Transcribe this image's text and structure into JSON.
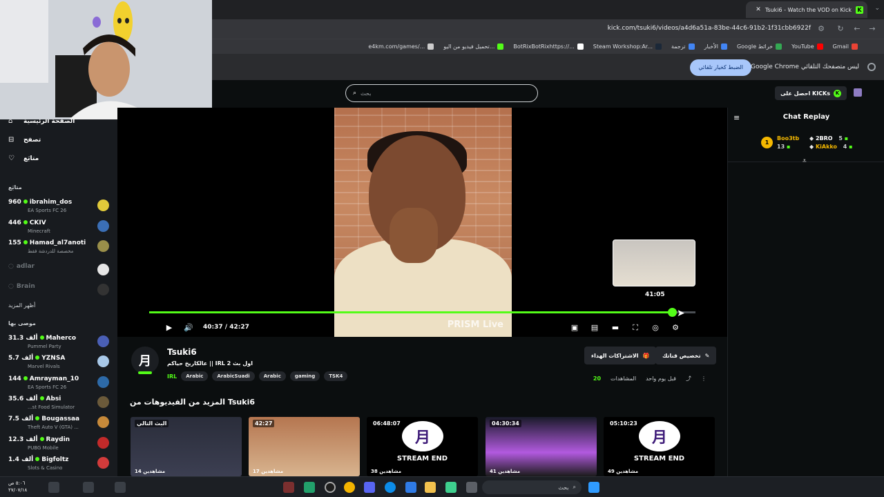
{
  "browser": {
    "tab_title": "Tsuki6 - Watch the VOD on Kick",
    "url": "kick.com/tsuki6/videos/a4d6a51a-83be-44c6-91b2-1f31cbb6922f",
    "bookmarks": [
      {
        "label": "Gmail",
        "color": "#ea4335"
      },
      {
        "label": "YouTube",
        "color": "#ff0000"
      },
      {
        "label": "Google خرائط",
        "color": "#34a853"
      },
      {
        "label": "الأخبار",
        "color": "#4285f4"
      },
      {
        "label": "ترجمة",
        "color": "#4285f4"
      },
      {
        "label": "Steam Workshop:Ar...",
        "color": "#1b2838"
      },
      {
        "label": "BotRixBotRixhttps://...",
        "color": "#ffffff"
      },
      {
        "label": "تحميل فيديو من اليو...",
        "color": "#53fc18"
      },
      {
        "label": "e4km.com/games/...",
        "color": "#cccccc"
      }
    ],
    "infobar_message": "Google Chrome ليس متصفحك التلقائي",
    "infobar_button": "الضبط كخيار تلقائي"
  },
  "header": {
    "search_placeholder": "بحث",
    "get_kicks": "احصل على KICKs"
  },
  "sidebar": {
    "nav": [
      {
        "label": "الصفحة الرئيسية",
        "icon": "home-icon"
      },
      {
        "label": "تصفح",
        "icon": "browse-icon"
      },
      {
        "label": "متابَع",
        "icon": "heart-icon"
      }
    ],
    "following_heading": "متابَع",
    "following": [
      {
        "viewers": "960",
        "name": "ibrahim_dos",
        "game": "EA Sports FC 26",
        "live": true,
        "avatar_color": "#e0c93a"
      },
      {
        "viewers": "446",
        "name": "CKIV",
        "game": "Minecraft",
        "live": true,
        "avatar_color": "#3b6fb6"
      },
      {
        "viewers": "155",
        "name": "Hamad_al7anoti",
        "game": "مخصصة للدردشة فقط",
        "live": true,
        "avatar_color": "#9a8f4a"
      },
      {
        "viewers": "",
        "name": "adlar",
        "game": "",
        "live": false,
        "avatar_color": "#e6e6e6"
      },
      {
        "viewers": "",
        "name": "Brain",
        "game": "",
        "live": false,
        "avatar_color": "#333333"
      }
    ],
    "show_more": "أظهر المزيد",
    "recommended_heading": "موصى بها",
    "recommended": [
      {
        "viewers": "31.3 ألف",
        "name": "Maherco",
        "game": "Pummel Party",
        "avatar_color": "#4a5fb5"
      },
      {
        "viewers": "5.7 ألف",
        "name": "YZNSA",
        "game": "Marvel Rivals",
        "avatar_color": "#a8c8e8"
      },
      {
        "viewers": "144",
        "name": "Amrayman_10",
        "game": "EA Sports FC 26",
        "avatar_color": "#2d6aa8"
      },
      {
        "viewers": "35.6 ألف",
        "name": "Absi",
        "game": "...st Food Simulator",
        "avatar_color": "#6b5a3a"
      },
      {
        "viewers": "7.5 ألف",
        "name": "Bougassaa",
        "game": "Theft Auto V (GTA) ...",
        "avatar_color": "#c78a3a"
      },
      {
        "viewers": "12.3 ألف",
        "name": "Raydin",
        "game": "PUBG Mobile",
        "avatar_color": "#c22a2a"
      },
      {
        "viewers": "1.4 ألف",
        "name": "Bigfoltz",
        "game": "Slots & Casino",
        "avatar_color": "#d23b3b"
      }
    ]
  },
  "player": {
    "watermark": "PRISM Live",
    "preview_time": "41:05",
    "current_time": "40:37",
    "duration": "42:27",
    "progress_fraction": 0.957
  },
  "chat": {
    "title": "Chat Replay",
    "rank": "1",
    "leaders": [
      {
        "name": "Boo3tb",
        "count": "13",
        "color": "#f5b800"
      },
      {
        "name": "2BRO",
        "count": "5",
        "color": "#ffffff"
      },
      {
        "name": "KiAkko",
        "count": "4",
        "color": "#f5b800"
      }
    ]
  },
  "video_info": {
    "channel": "Tsuki6",
    "avatar_letter": "月",
    "title": "عالكاريخ حياكم || IRL 2 اول بث",
    "category": "IRL",
    "tags": [
      "Arabic",
      "ArabicSuadi",
      "Arabic",
      "gaming",
      "TSK4"
    ],
    "subs_button": "الاشتراكات الهداء",
    "clip_button": "تخصيص قناتك",
    "time_ago": "قبل يوم واحد",
    "views_label": "المشاهدات",
    "views": "20"
  },
  "more_heading": "المزيد من الفيديوهات من Tsuki6",
  "thumbnails": [
    {
      "duration": "البث التالي",
      "views": "14 مشاهدين",
      "kind": "screen"
    },
    {
      "duration": "42:27",
      "views": "17 مشاهدين",
      "kind": "face"
    },
    {
      "duration": "06:48:07",
      "views": "38 مشاهدين",
      "kind": "end",
      "end_text": "STREAM END"
    },
    {
      "duration": "04:30:34",
      "views": "41 مشاهدين",
      "kind": "purple"
    },
    {
      "duration": "05:10:23",
      "views": "49 مشاهدين",
      "kind": "end",
      "end_text": "STREAM END"
    }
  ],
  "taskbar": {
    "search_placeholder": "بحث",
    "clock_time": "٥:٠٦ ص",
    "clock_date": "٢٧/٠٧/١٨"
  }
}
